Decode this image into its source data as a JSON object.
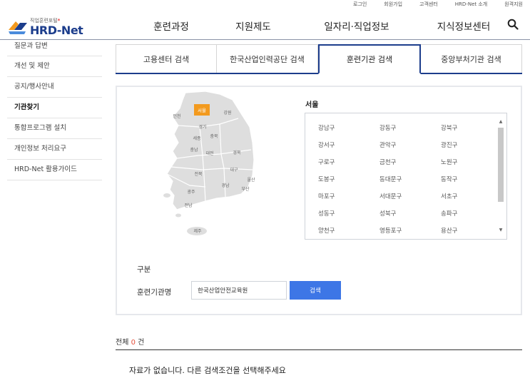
{
  "utility_links": [
    "로그인",
    "회원가입",
    "고객센터",
    "HRD-Net 소개",
    "원격지원"
  ],
  "logo": {
    "subtitle": "직업훈련포털",
    "name": "HRD-Net"
  },
  "gnb": [
    "훈련과정",
    "지원제도",
    "일자리·직업정보",
    "지식정보센터"
  ],
  "lnb": [
    {
      "label": "질문과 답변",
      "active": false
    },
    {
      "label": "개선 및 제안",
      "active": false
    },
    {
      "label": "공지/행사안내",
      "active": false
    },
    {
      "label": "기관찾기",
      "active": true
    },
    {
      "label": "통합프로그램 설치",
      "active": false
    },
    {
      "label": "개인정보 처리요구",
      "active": false
    },
    {
      "label": "HRD-Net 활용가이드",
      "active": false
    }
  ],
  "tabs": [
    {
      "label": "고용센터 검색",
      "active": false
    },
    {
      "label": "한국산업인력공단 검색",
      "active": false
    },
    {
      "label": "훈련기관 검색",
      "active": true
    },
    {
      "label": "중앙부처기관 검색",
      "active": false
    }
  ],
  "map": {
    "selected_region": "서울",
    "regions": [
      "서울",
      "인천",
      "강원",
      "경기",
      "세종",
      "충북",
      "충남",
      "대전",
      "경북",
      "대구",
      "전북",
      "울산",
      "경남",
      "부산",
      "광주",
      "전남",
      "제주"
    ],
    "highlight_color": "#f39a1e"
  },
  "region_title": "서울",
  "districts": [
    "강남구",
    "강동구",
    "강북구",
    "강서구",
    "관악구",
    "광진구",
    "구로구",
    "금천구",
    "노원구",
    "도봉구",
    "동대문구",
    "동작구",
    "마포구",
    "서대문구",
    "서초구",
    "성동구",
    "성북구",
    "송파구",
    "양천구",
    "영등포구",
    "용산구"
  ],
  "form": {
    "category_label": "구분",
    "name_label": "훈련기관명",
    "name_value": "한국산업안전교육원",
    "search_label": "검색"
  },
  "result": {
    "total_label": "전체",
    "count": "0",
    "unit": "건",
    "empty_message": "자료가 없습니다. 다른 검색조건을 선택해주세요"
  }
}
